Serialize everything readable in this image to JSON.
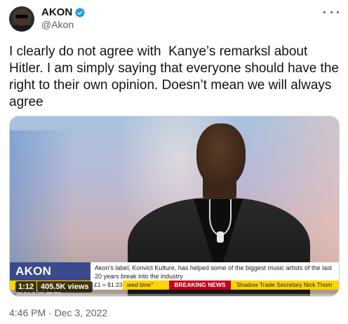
{
  "user": {
    "display_name": "AKON",
    "handle": "@Akon",
    "verified": true,
    "avatar_icon": "profile-avatar"
  },
  "more_menu_icon": "more-horizontal-icon",
  "tweet": {
    "text": "I clearly do not agree with  Kanye’s remarksl about Hitler. I am simply saying that everyone should have the right to their own opinion. Doesn’t mean we will always agree",
    "timestamp": "4:46 PM · Dec 3, 2022"
  },
  "video": {
    "time": "1:12",
    "views": "405.5K views",
    "progress": 0.02,
    "lower_third": {
      "title": "AKON SINGLE",
      "description": "Akon’s label, Konvict Kulture, has helped some of the biggest music artists of the last 20 years break into the industry"
    },
    "ticker": {
      "price": "£1 = $1.23",
      "segment_a": "wed time\"",
      "breaking": "BREAKING NEWS",
      "segment_b": "Shadow Trade Secretary Nick Thom"
    }
  },
  "colors": {
    "verified_blue": "#1d9bf0",
    "secondary_text": "#536471",
    "lower_third_blue": "#3a4a8c",
    "breaking_red": "#c4001a",
    "ticker_yellow": "#ffd400"
  }
}
